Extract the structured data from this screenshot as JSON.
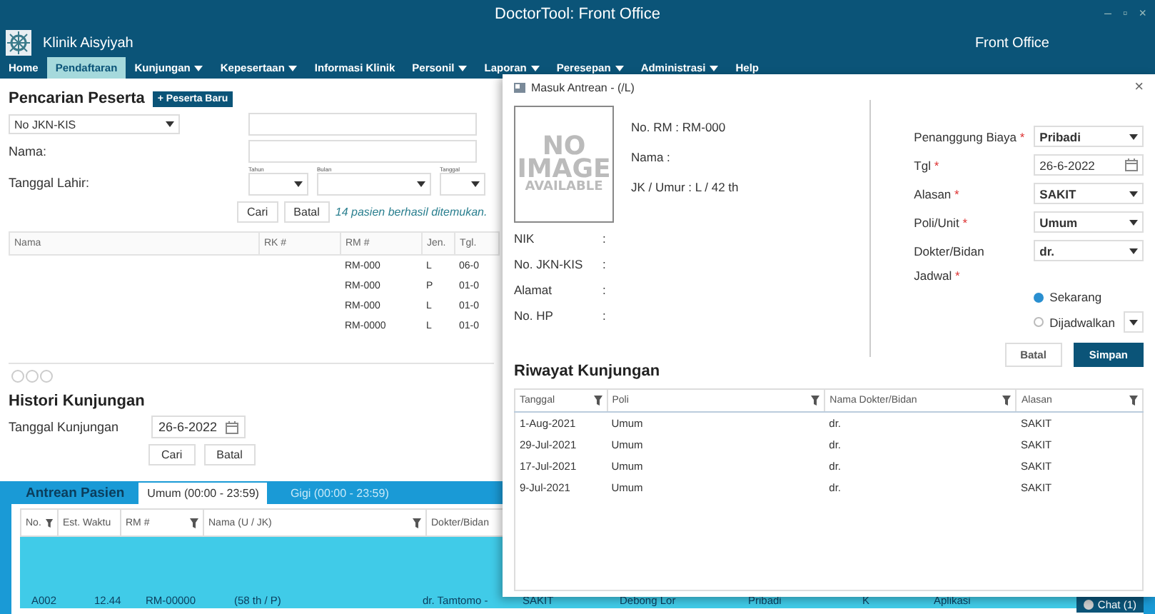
{
  "window": {
    "title": "DoctorTool: Front Office",
    "controls": [
      "–",
      "▫",
      "×"
    ]
  },
  "header": {
    "clinic": "Klinik Aisyiyah",
    "role": "Front Office"
  },
  "menu": [
    {
      "label": "Home",
      "dropdown": false,
      "selected": false
    },
    {
      "label": "Pendaftaran",
      "dropdown": false,
      "selected": true
    },
    {
      "label": "Kunjungan",
      "dropdown": true,
      "selected": false
    },
    {
      "label": "Kepesertaan",
      "dropdown": true,
      "selected": false
    },
    {
      "label": "Informasi Klinik",
      "dropdown": false,
      "selected": false
    },
    {
      "label": "Personil",
      "dropdown": true,
      "selected": false
    },
    {
      "label": "Laporan",
      "dropdown": true,
      "selected": false
    },
    {
      "label": "Peresepan",
      "dropdown": true,
      "selected": false
    },
    {
      "label": "Administrasi",
      "dropdown": true,
      "selected": false
    },
    {
      "label": "Help",
      "dropdown": false,
      "selected": false
    }
  ],
  "search": {
    "title": "Pencarian Peserta",
    "new_button": "+ Peserta Baru",
    "search_by": "No JKN-KIS",
    "name_label": "Nama:",
    "birth_label": "Tanggal Lahir:",
    "date_parts": [
      "Tahun",
      "Bulan",
      "Tanggal"
    ],
    "buttons": [
      "Cari",
      "Batal"
    ],
    "result": "14 pasien berhasil ditemukan."
  },
  "patients": {
    "columns": [
      "Nama",
      "RK #",
      "RM #",
      "Jen.",
      "Tgl."
    ],
    "rows": [
      {
        "rm": "RM-000",
        "jen": "L",
        "tgl": "06-0"
      },
      {
        "rm": "RM-000",
        "jen": "P",
        "tgl": "01-0"
      },
      {
        "rm": "RM-000",
        "jen": "L",
        "tgl": "01-0"
      },
      {
        "rm": "RM-0000",
        "jen": "L",
        "tgl": "01-0"
      }
    ]
  },
  "history": {
    "title": "Histori Kunjungan",
    "date_label": "Tanggal Kunjungan",
    "date": "26-6-2022",
    "buttons": [
      "Cari",
      "Batal"
    ]
  },
  "queue": {
    "title": "Antrean Pasien",
    "tabs": [
      {
        "label": "Umum (00:00 - 23:59)",
        "selected": true
      },
      {
        "label": "Gigi (00:00 - 23:59)",
        "selected": false
      }
    ],
    "columns": [
      {
        "label": "No.",
        "filter": true
      },
      {
        "label": "Est. Waktu",
        "filter": false
      },
      {
        "label": "RM #",
        "filter": true
      },
      {
        "label": "Nama (U / JK)",
        "filter": true
      },
      {
        "label": "Dokter/Bidan",
        "filter": false
      }
    ],
    "rows": [
      {
        "selected": true,
        "cells": [
          "A002",
          "12.44",
          "RM-00000",
          "(58 th / P)",
          "dr. Tamtomo -",
          "SAKIT",
          "Debong Lor",
          "Pribadi",
          "K",
          "Aplikasi"
        ]
      }
    ]
  },
  "chat": {
    "label": "Chat (1)"
  },
  "dialog": {
    "title": "Masuk Antrean - (/L)",
    "close": "×",
    "no_image": [
      "NO",
      "IMAGE",
      "AVAILABLE"
    ],
    "summary": [
      "No. RM : RM-000",
      "Nama :",
      "JK / Umur : L / 42 th"
    ],
    "details": [
      {
        "label": "NIK",
        "sep": ":"
      },
      {
        "label": "No. JKN-KIS",
        "sep": ":"
      },
      {
        "label": "Alamat",
        "sep": ":"
      },
      {
        "label": "No. HP",
        "sep": ":"
      }
    ],
    "form": [
      {
        "label": "Penanggung Biaya",
        "mark": "*",
        "kind": "select",
        "value": "Pribadi"
      },
      {
        "label": "Tgl",
        "mark": "*",
        "kind": "date",
        "value": "26-6-2022"
      },
      {
        "label": "Alasan",
        "mark": "*",
        "kind": "select",
        "value": "SAKIT"
      },
      {
        "label": "Poli/Unit",
        "mark": "*",
        "kind": "select",
        "value": "Umum"
      },
      {
        "label": "Dokter/Bidan",
        "kind": "select",
        "value": "dr."
      }
    ],
    "schedule": {
      "label": "Jadwal",
      "mark": "*",
      "options": [
        {
          "label": "Sekarang",
          "selected": true
        },
        {
          "label": "Dijadwalkan",
          "selected": false
        }
      ]
    },
    "buttons": [
      {
        "label": "Batal",
        "primary": false
      },
      {
        "label": "Simpan",
        "primary": true
      }
    ],
    "history_title": "Riwayat Kunjungan",
    "history_columns": [
      "Tanggal",
      "Poli",
      "Nama Dokter/Bidan",
      "Alasan"
    ],
    "history_rows": [
      [
        "1-Aug-2021",
        "Umum",
        "dr.",
        "SAKIT"
      ],
      [
        "29-Jul-2021",
        "Umum",
        "dr.",
        "SAKIT"
      ],
      [
        "17-Jul-2021",
        "Umum",
        "dr.",
        "SAKIT"
      ],
      [
        "9-Jul-2021",
        "Umum",
        "dr.",
        "SAKIT"
      ]
    ]
  }
}
